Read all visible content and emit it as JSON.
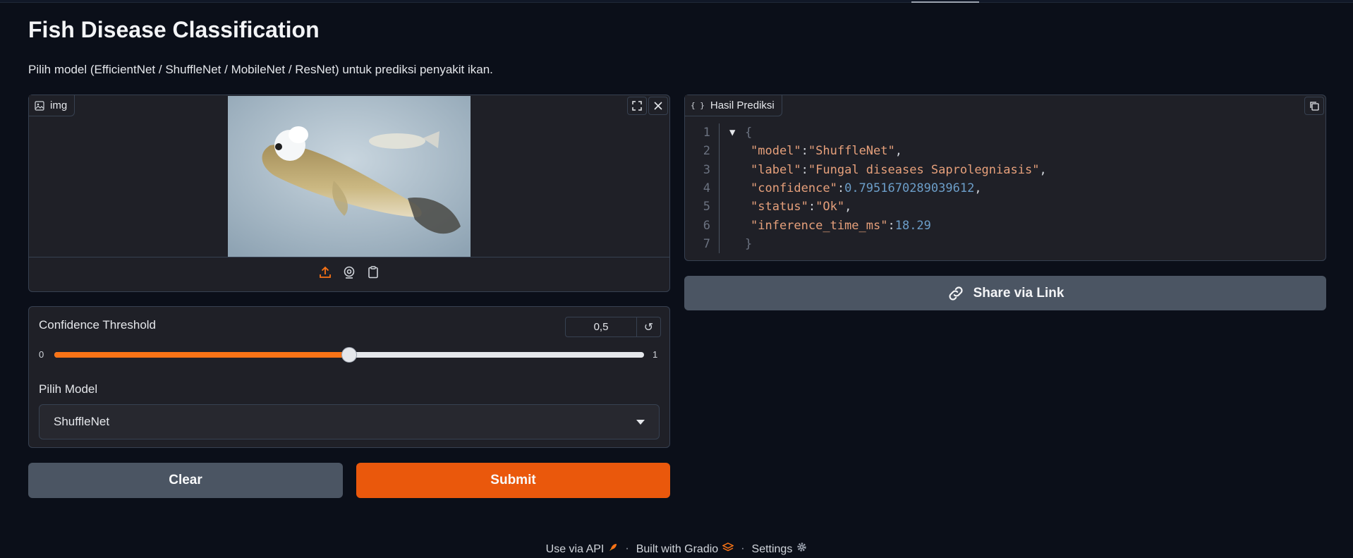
{
  "header": {
    "title": "Fish Disease Classification",
    "description": "Pilih model (EfficientNet / ShuffleNet / MobileNet / ResNet) untuk prediksi penyakit ikan."
  },
  "image_input": {
    "label": "img",
    "icons": [
      "fullscreen-icon",
      "close-icon",
      "upload-icon",
      "webcam-icon",
      "clipboard-icon"
    ]
  },
  "output": {
    "label": "Hasil Prediksi",
    "json": {
      "model": "ShuffleNet",
      "label": "Fungal diseases Saprolegniasis",
      "confidence": "0.7951670289039612",
      "status": "Ok",
      "inference_time_ms": "18.29"
    },
    "line_numbers": [
      "1",
      "2",
      "3",
      "4",
      "5",
      "6",
      "7"
    ]
  },
  "share_label": "Share via Link",
  "controls": {
    "threshold_label": "Confidence Threshold",
    "threshold_value": "0,5",
    "threshold_fraction": 0.5,
    "min_label": "0",
    "max_label": "1",
    "model_label": "Pilih Model",
    "model_selected": "ShuffleNet"
  },
  "buttons": {
    "clear": "Clear",
    "submit": "Submit"
  },
  "footer": {
    "api": "Use via API",
    "built": "Built with Gradio",
    "settings": "Settings",
    "sep": "·"
  },
  "colors": {
    "accent": "#ea580c",
    "background": "#0b0f19",
    "panel": "#1f2027"
  }
}
